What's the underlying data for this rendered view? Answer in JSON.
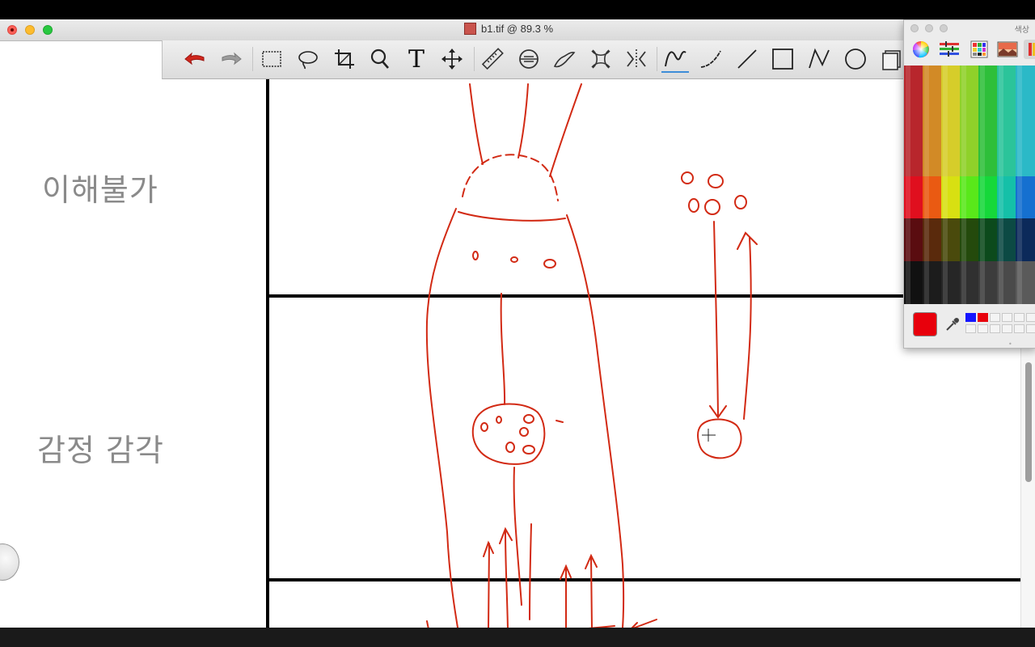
{
  "window": {
    "title": "b1.tif @ 89.3 %"
  },
  "toolbar": {
    "tools": [
      {
        "name": "undo-icon"
      },
      {
        "name": "redo-icon"
      },
      {
        "name": "rect-select-icon"
      },
      {
        "name": "lasso-icon"
      },
      {
        "name": "crop-icon"
      },
      {
        "name": "zoom-icon"
      },
      {
        "name": "text-icon",
        "glyph": "T"
      },
      {
        "name": "move-icon"
      },
      {
        "name": "ruler-icon"
      },
      {
        "name": "level-icon"
      },
      {
        "name": "smudge-icon"
      },
      {
        "name": "transform-icon"
      },
      {
        "name": "flip-icon"
      },
      {
        "name": "freehand-icon"
      },
      {
        "name": "curve-icon"
      },
      {
        "name": "line-icon"
      },
      {
        "name": "rectangle-icon"
      },
      {
        "name": "polyline-icon"
      },
      {
        "name": "ellipse-icon"
      },
      {
        "name": "stamp-icon"
      }
    ],
    "active_tool": "freehand-icon"
  },
  "canvas": {
    "labels": [
      "이해불가",
      "감정 감각"
    ],
    "ink_color": "#d22a14",
    "line_color": "#000000"
  },
  "color_panel": {
    "title": "색상",
    "modes": [
      "color-wheel-icon",
      "sliders-icon",
      "palette-icon",
      "image-icon",
      "pencils-icon"
    ],
    "active_mode": "pencils-icon",
    "current_color": "#e8000c",
    "recent_swatches": [
      "#1515ff",
      "#e8000c"
    ]
  }
}
